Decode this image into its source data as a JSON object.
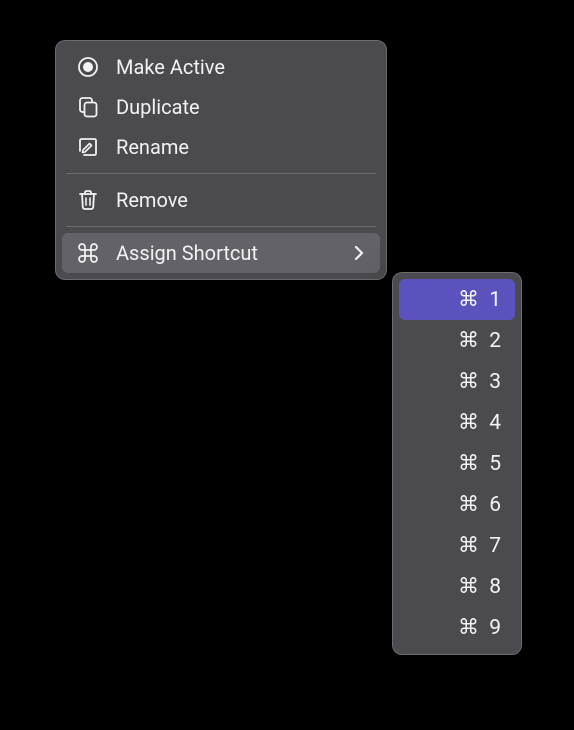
{
  "menu": {
    "items": [
      {
        "label": "Make Active"
      },
      {
        "label": "Duplicate"
      },
      {
        "label": "Rename"
      },
      {
        "label": "Remove"
      },
      {
        "label": "Assign Shortcut"
      }
    ]
  },
  "submenu": {
    "cmd_symbol": "⌘",
    "items": [
      {
        "num": "1"
      },
      {
        "num": "2"
      },
      {
        "num": "3"
      },
      {
        "num": "4"
      },
      {
        "num": "5"
      },
      {
        "num": "6"
      },
      {
        "num": "7"
      },
      {
        "num": "8"
      },
      {
        "num": "9"
      }
    ]
  }
}
